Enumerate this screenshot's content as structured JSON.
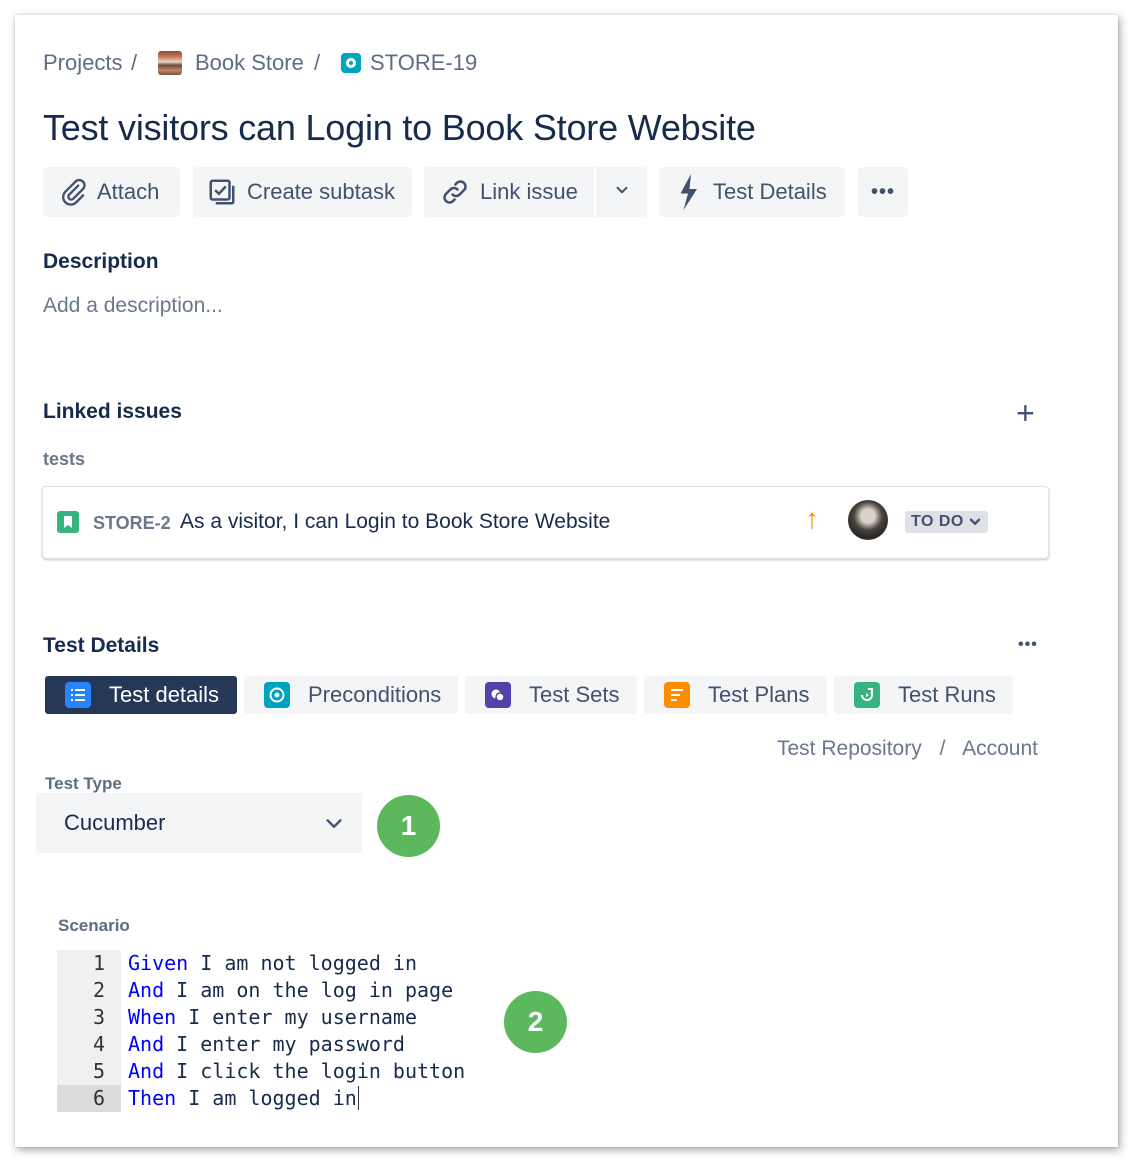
{
  "breadcrumb": {
    "projects": "Projects",
    "separator": "/",
    "project": "Book Store",
    "issue_key": "STORE-19"
  },
  "issue": {
    "title": "Test visitors can Login to Book Store Website"
  },
  "toolbar": {
    "attach": "Attach",
    "create_subtask": "Create subtask",
    "link_issue": "Link issue",
    "test_details": "Test Details",
    "more": "•••"
  },
  "description": {
    "title": "Description",
    "placeholder": "Add a description..."
  },
  "linked_issues": {
    "title": "Linked issues",
    "add": "+",
    "relation": "tests",
    "items": [
      {
        "key": "STORE-2",
        "summary": "As a visitor, I can Login to Book Store Website",
        "priority": "↑",
        "status": "TO DO"
      }
    ]
  },
  "test_details": {
    "title": "Test Details",
    "more": "•••",
    "tabs": [
      {
        "label": "Test details",
        "active": true
      },
      {
        "label": "Preconditions",
        "active": false
      },
      {
        "label": "Test Sets",
        "active": false
      },
      {
        "label": "Test Plans",
        "active": false
      },
      {
        "label": "Test Runs",
        "active": false
      }
    ],
    "repo_path": {
      "root": "Test Repository",
      "separator": "/",
      "folder": "Account"
    },
    "test_type": {
      "label": "Test Type",
      "value": "Cucumber"
    },
    "scenario": {
      "label": "Scenario",
      "lines": [
        {
          "num": "1",
          "keyword": "Given",
          "text": " I am not logged in"
        },
        {
          "num": "2",
          "keyword": "And",
          "text": " I am on the log in page"
        },
        {
          "num": "3",
          "keyword": "When",
          "text": " I enter my username"
        },
        {
          "num": "4",
          "keyword": "And",
          "text": " I enter my password"
        },
        {
          "num": "5",
          "keyword": "And",
          "text": " I click the login button"
        },
        {
          "num": "6",
          "keyword": "Then",
          "text": " I am logged in"
        }
      ]
    }
  },
  "callouts": [
    "1",
    "2"
  ],
  "colors": {
    "text": "#172b4d",
    "muted": "#5e6c84",
    "active_tab": "#253858",
    "badge": "#5cb85c",
    "priority": "#ff8b00",
    "keyword": "#0000ff"
  }
}
